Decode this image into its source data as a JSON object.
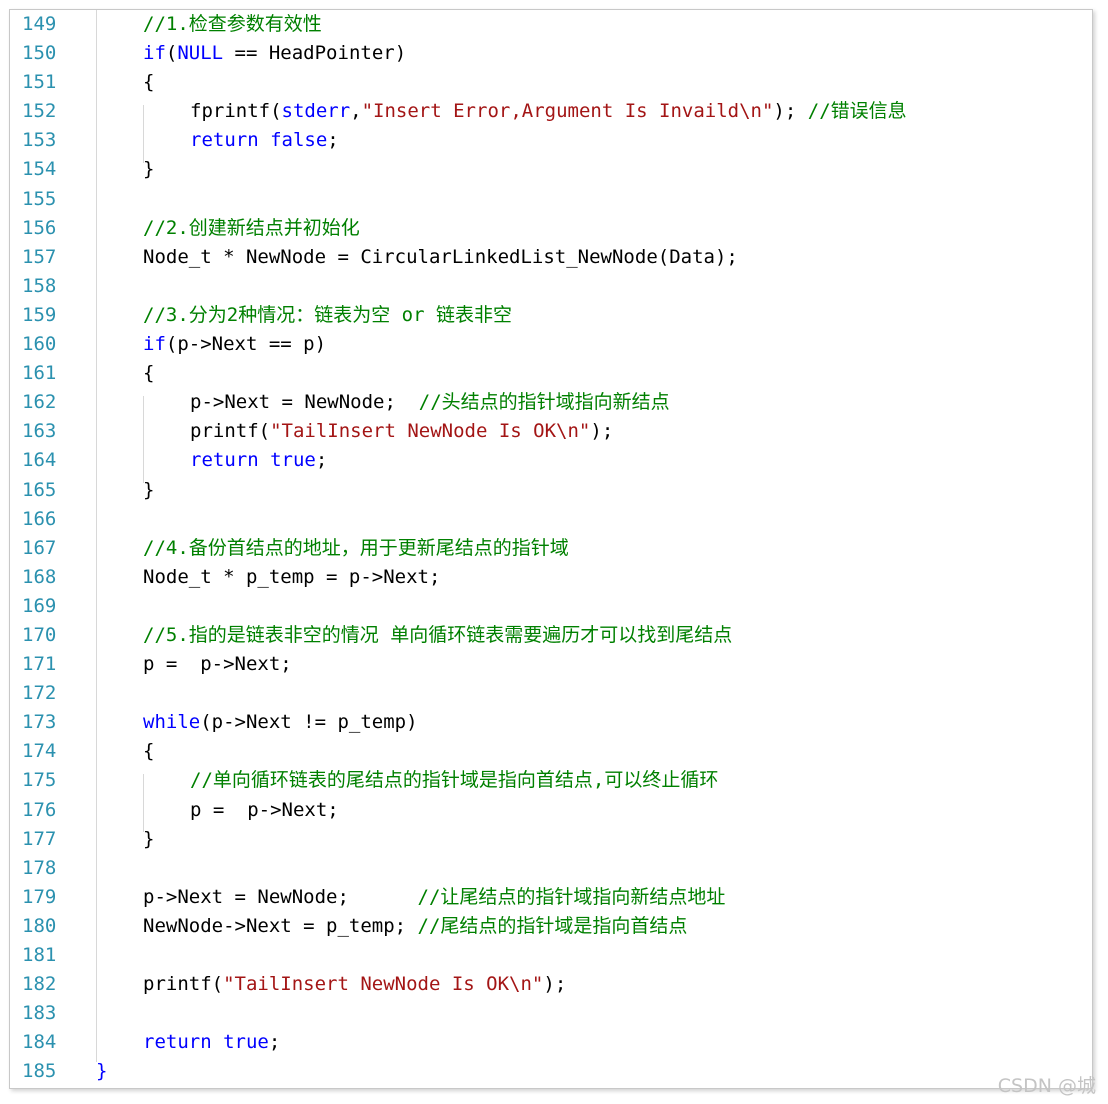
{
  "colors": {
    "keyword": "#0000ff",
    "string": "#a31515",
    "comment": "#008000",
    "plain": "#000000",
    "line_number": "#2b91af"
  },
  "watermark": "CSDN @城",
  "lines": [
    {
      "n": "149",
      "indent": 1,
      "tokens": [
        {
          "t": "c",
          "v": "//1.检查参数有效性"
        }
      ]
    },
    {
      "n": "150",
      "indent": 1,
      "tokens": [
        {
          "t": "k",
          "v": "if"
        },
        {
          "t": "p",
          "v": "("
        },
        {
          "t": "k",
          "v": "NULL"
        },
        {
          "t": "p",
          "v": " == HeadPointer)"
        }
      ]
    },
    {
      "n": "151",
      "indent": 1,
      "tokens": [
        {
          "t": "p",
          "v": "{"
        }
      ]
    },
    {
      "n": "152",
      "indent": 2,
      "tokens": [
        {
          "t": "p",
          "v": "fprintf("
        },
        {
          "t": "k",
          "v": "stderr"
        },
        {
          "t": "p",
          "v": ","
        },
        {
          "t": "s",
          "v": "\"Insert Error,Argument Is Invaild\\n\""
        },
        {
          "t": "p",
          "v": "); "
        },
        {
          "t": "c",
          "v": "//错误信息"
        }
      ]
    },
    {
      "n": "153",
      "indent": 2,
      "tokens": [
        {
          "t": "k",
          "v": "return"
        },
        {
          "t": "p",
          "v": " "
        },
        {
          "t": "k",
          "v": "false"
        },
        {
          "t": "p",
          "v": ";"
        }
      ]
    },
    {
      "n": "154",
      "indent": 1,
      "tokens": [
        {
          "t": "p",
          "v": "}"
        }
      ]
    },
    {
      "n": "155",
      "indent": 0,
      "tokens": []
    },
    {
      "n": "156",
      "indent": 1,
      "tokens": [
        {
          "t": "c",
          "v": "//2.创建新结点并初始化"
        }
      ]
    },
    {
      "n": "157",
      "indent": 1,
      "tokens": [
        {
          "t": "p",
          "v": "Node_t * NewNode = CircularLinkedList_NewNode(Data);"
        }
      ]
    },
    {
      "n": "158",
      "indent": 0,
      "tokens": []
    },
    {
      "n": "159",
      "indent": 1,
      "tokens": [
        {
          "t": "c",
          "v": "//3.分为2种情况：链表为空 or 链表非空"
        }
      ]
    },
    {
      "n": "160",
      "indent": 1,
      "tokens": [
        {
          "t": "k",
          "v": "if"
        },
        {
          "t": "p",
          "v": "(p->Next == p)"
        }
      ]
    },
    {
      "n": "161",
      "indent": 1,
      "tokens": [
        {
          "t": "p",
          "v": "{"
        }
      ]
    },
    {
      "n": "162",
      "indent": 2,
      "tokens": [
        {
          "t": "p",
          "v": "p->Next = NewNode;  "
        },
        {
          "t": "c",
          "v": "//头结点的指针域指向新结点"
        }
      ]
    },
    {
      "n": "163",
      "indent": 2,
      "tokens": [
        {
          "t": "p",
          "v": "printf("
        },
        {
          "t": "s",
          "v": "\"TailInsert NewNode Is OK\\n\""
        },
        {
          "t": "p",
          "v": ");"
        }
      ]
    },
    {
      "n": "164",
      "indent": 2,
      "tokens": [
        {
          "t": "k",
          "v": "return"
        },
        {
          "t": "p",
          "v": " "
        },
        {
          "t": "k",
          "v": "true"
        },
        {
          "t": "p",
          "v": ";"
        }
      ]
    },
    {
      "n": "165",
      "indent": 1,
      "tokens": [
        {
          "t": "p",
          "v": "}"
        }
      ]
    },
    {
      "n": "166",
      "indent": 0,
      "tokens": []
    },
    {
      "n": "167",
      "indent": 1,
      "tokens": [
        {
          "t": "c",
          "v": "//4.备份首结点的地址，用于更新尾结点的指针域"
        }
      ]
    },
    {
      "n": "168",
      "indent": 1,
      "tokens": [
        {
          "t": "p",
          "v": "Node_t * p_temp = p->Next;"
        }
      ]
    },
    {
      "n": "169",
      "indent": 0,
      "tokens": []
    },
    {
      "n": "170",
      "indent": 1,
      "tokens": [
        {
          "t": "c",
          "v": "//5.指的是链表非空的情况 单向循环链表需要遍历才可以找到尾结点"
        }
      ]
    },
    {
      "n": "171",
      "indent": 1,
      "tokens": [
        {
          "t": "p",
          "v": "p =  p->Next;"
        }
      ]
    },
    {
      "n": "172",
      "indent": 0,
      "tokens": []
    },
    {
      "n": "173",
      "indent": 1,
      "tokens": [
        {
          "t": "k",
          "v": "while"
        },
        {
          "t": "p",
          "v": "(p->Next != p_temp)"
        }
      ]
    },
    {
      "n": "174",
      "indent": 1,
      "tokens": [
        {
          "t": "p",
          "v": "{"
        }
      ]
    },
    {
      "n": "175",
      "indent": 2,
      "tokens": [
        {
          "t": "c",
          "v": "//单向循环链表的尾结点的指针域是指向首结点,可以终止循环"
        }
      ]
    },
    {
      "n": "176",
      "indent": 2,
      "tokens": [
        {
          "t": "p",
          "v": "p =  p->Next;"
        }
      ]
    },
    {
      "n": "177",
      "indent": 1,
      "tokens": [
        {
          "t": "p",
          "v": "}"
        }
      ]
    },
    {
      "n": "178",
      "indent": 0,
      "tokens": []
    },
    {
      "n": "179",
      "indent": 1,
      "tokens": [
        {
          "t": "p",
          "v": "p->Next = NewNode;      "
        },
        {
          "t": "c",
          "v": "//让尾结点的指针域指向新结点地址"
        }
      ]
    },
    {
      "n": "180",
      "indent": 1,
      "tokens": [
        {
          "t": "p",
          "v": "NewNode->Next = p_temp; "
        },
        {
          "t": "c",
          "v": "//尾结点的指针域是指向首结点"
        }
      ]
    },
    {
      "n": "181",
      "indent": 0,
      "tokens": []
    },
    {
      "n": "182",
      "indent": 1,
      "tokens": [
        {
          "t": "p",
          "v": "printf("
        },
        {
          "t": "s",
          "v": "\"TailInsert NewNode Is OK\\n\""
        },
        {
          "t": "p",
          "v": ");"
        }
      ]
    },
    {
      "n": "183",
      "indent": 0,
      "tokens": []
    },
    {
      "n": "184",
      "indent": 1,
      "tokens": [
        {
          "t": "k",
          "v": "return"
        },
        {
          "t": "p",
          "v": " "
        },
        {
          "t": "k",
          "v": "true"
        },
        {
          "t": "p",
          "v": ";"
        }
      ]
    },
    {
      "n": "185",
      "indent": 0,
      "tokens": [
        {
          "t": "k",
          "v": "}"
        }
      ]
    }
  ]
}
